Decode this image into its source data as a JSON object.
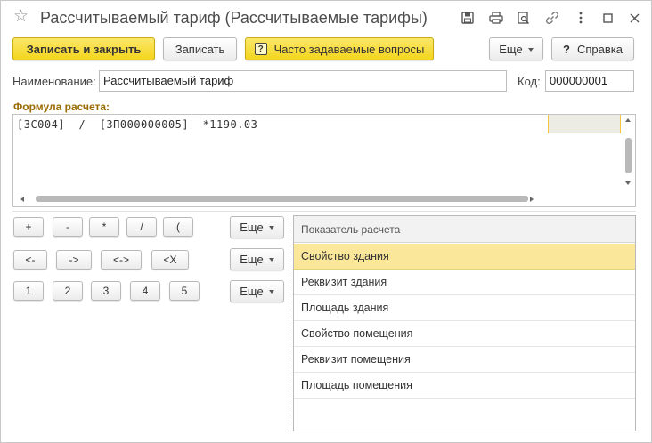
{
  "window": {
    "title": "Рассчитываемый тариф (Рассчитываемые тарифы)"
  },
  "toolbar": {
    "save_close": "Записать и закрыть",
    "save": "Записать",
    "faq": "Часто задаваемые вопросы",
    "more": "Еще",
    "help": "Справка"
  },
  "form": {
    "name_label": "Наименование:",
    "name_value": "Рассчитываемый тариф",
    "code_label": "Код:",
    "code_value": "000000001",
    "formula_label": "Формула расчета:",
    "formula_value": "[ЗС004]  /  [ЗП000000005]  *1190.03"
  },
  "keypad": {
    "ops": [
      "+",
      "-",
      "*",
      "/",
      "("
    ],
    "nav": [
      "<-",
      "->",
      "<->",
      "<X"
    ],
    "digits": [
      "1",
      "2",
      "3",
      "4",
      "5"
    ],
    "more": "Еще"
  },
  "list": {
    "header": "Показатель расчета",
    "items": [
      "Свойство здания",
      "Реквизит здания",
      "Площадь здания",
      "Свойство помещения",
      "Реквизит помещения",
      "Площадь помещения"
    ],
    "selected_index": 0
  },
  "colors": {
    "accent_yellow": "#f3d51d",
    "selection": "#fbe79a",
    "formula_label": "#9a6a00"
  }
}
